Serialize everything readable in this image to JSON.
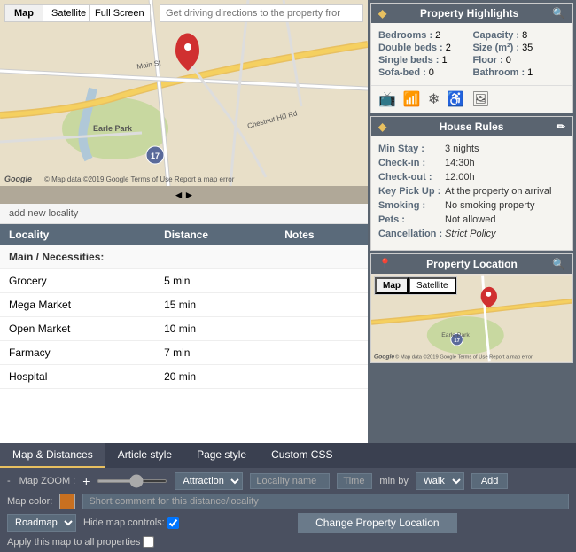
{
  "map": {
    "tabs": [
      "Map",
      "Satellite"
    ],
    "active_tab": "Map",
    "fullscreen_label": "Full Screen",
    "directions_placeholder": "Get driving directions to the property fror",
    "copyright": "© Map data ©2019 Google",
    "terms": "Terms of Use",
    "report": "Report a map error",
    "divider_arrows": "◄►"
  },
  "localities": {
    "add_label": "add new locality",
    "columns": [
      "Locality",
      "Distance",
      "Notes"
    ],
    "categories": [
      {
        "name": "Main / Necessities:",
        "items": [
          {
            "name": "Grocery",
            "distance": "5 min",
            "notes": ""
          },
          {
            "name": "Mega Market",
            "distance": "15 min",
            "notes": ""
          },
          {
            "name": "Open Market",
            "distance": "10 min",
            "notes": ""
          },
          {
            "name": "Farmacy",
            "distance": "7 min",
            "notes": ""
          },
          {
            "name": "Hospital",
            "distance": "20 min",
            "notes": ""
          }
        ]
      }
    ]
  },
  "property_highlights": {
    "title": "Property Highlights",
    "fields": [
      {
        "label": "Bedrooms :",
        "value": "2"
      },
      {
        "label": "Capacity :",
        "value": "8"
      },
      {
        "label": "Double beds :",
        "value": "2"
      },
      {
        "label": "Size (m²) :",
        "value": "35"
      },
      {
        "label": "Single beds :",
        "value": "1"
      },
      {
        "label": "Floor :",
        "value": "0"
      },
      {
        "label": "Sofa-bed :",
        "value": "0"
      },
      {
        "label": "Bathroom :",
        "value": "1"
      }
    ],
    "amenity_icons": [
      "tv-icon",
      "wifi-icon",
      "ac-icon",
      "wheelchair-icon",
      "photo-icon"
    ]
  },
  "house_rules": {
    "title": "House Rules",
    "rules": [
      {
        "label": "Min Stay :",
        "value": "3 nights",
        "italic": false
      },
      {
        "label": "Check-in :",
        "value": "14:30h",
        "italic": false
      },
      {
        "label": "Check-out :",
        "value": "12:00h",
        "italic": false
      },
      {
        "label": "Key Pick Up :",
        "value": "At the property on arrival",
        "italic": false
      },
      {
        "label": "Smoking :",
        "value": "No smoking property",
        "italic": false
      },
      {
        "label": "Pets :",
        "value": "Not allowed",
        "italic": false
      },
      {
        "label": "Cancellation :",
        "value": "Strict Policy",
        "italic": true
      }
    ]
  },
  "property_location": {
    "title": "Property Location",
    "map_tabs": [
      "Map",
      "Satellite"
    ],
    "active_tab": "Map",
    "earle_park": "Earle Park",
    "copyright": "© Map data ©2019 Google",
    "terms": "Terms of Use",
    "report": "Report a map error"
  },
  "toolbar": {
    "tabs": [
      "Map & Distances",
      "Article style",
      "Page style",
      "Custom CSS"
    ],
    "active_tab": "Map & Distances",
    "zoom_label": "Map ZOOM :",
    "zoom_minus": "-",
    "zoom_plus": "+",
    "attraction_options": [
      "Attraction"
    ],
    "locality_placeholder": "Locality name",
    "time_placeholder": "Time",
    "min_by_label": "min by",
    "walk_options": [
      "Walk"
    ],
    "add_label": "Add",
    "map_color_label": "Map color:",
    "roadmap_options": [
      "Roadmap"
    ],
    "hide_controls_label": "Hide map controls:",
    "apply_label": "Apply this map to all properties",
    "comment_placeholder": "Short comment for this distance/locality",
    "change_location_label": "Change Property Location"
  }
}
